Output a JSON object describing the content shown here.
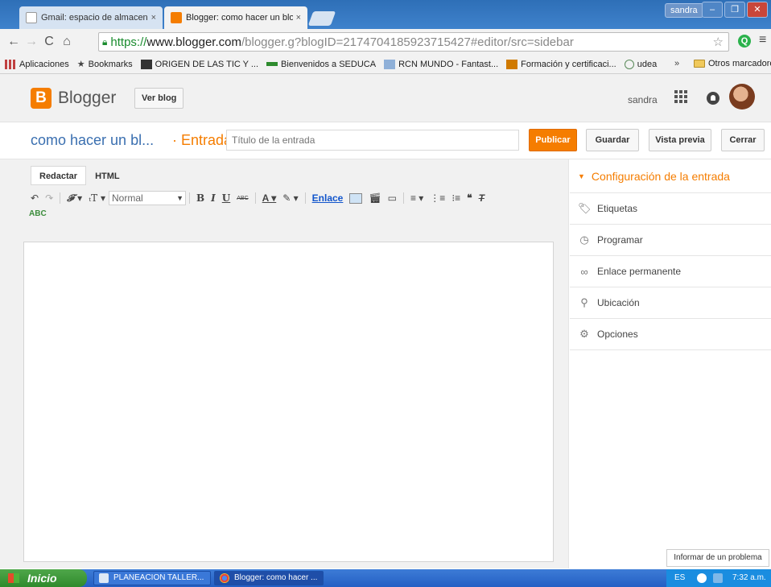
{
  "browser": {
    "tabs": [
      {
        "title": "Gmail: espacio de almacenam",
        "close": "×",
        "active": false
      },
      {
        "title": "Blogger: como hacer un blog",
        "close": "×",
        "active": true
      }
    ],
    "profile_user": "sandra",
    "window_buttons": [
      "–",
      "❐",
      "✕"
    ],
    "url": {
      "scheme": "https://",
      "host": "www.blogger.com",
      "path": "/blogger.g?blogID=2174704185923715427#editor/src=sidebar"
    },
    "extension_label": "Q",
    "bookmarks": [
      {
        "label": "Aplicaciones",
        "icon": "apps-grid-icon",
        "color": "#c04040"
      },
      {
        "label": "Bookmarks",
        "icon": "star-icon",
        "color": "#444444"
      },
      {
        "label": "ORIGEN DE LAS TIC Y ...",
        "icon": "ci-logo-icon",
        "color": "#333333"
      },
      {
        "label": "Bienvenidos a SEDUCA",
        "icon": "seduca-icon",
        "color": "#2e8b2e"
      },
      {
        "label": "RCN MUNDO - Fantast...",
        "icon": "rcn-icon",
        "color": "#3a6fb0"
      },
      {
        "label": "Formación y certificaci...",
        "icon": "fm-icon",
        "color": "#d07a00"
      },
      {
        "label": "udea",
        "icon": "udea-icon",
        "color": "#5a8a5a"
      }
    ],
    "bookmarks_more": "»",
    "bookmarks_other": "Otros marcadores"
  },
  "blogger": {
    "logo_letter": "B",
    "brand": "Blogger",
    "view_blog": "Ver blog",
    "username": "sandra",
    "blog_name": "como hacer un bl...",
    "section": "· Entrada",
    "title_placeholder": "Título de la entrada",
    "buttons": {
      "publish": "Publicar",
      "save": "Guardar",
      "preview": "Vista previa",
      "close": "Cerrar"
    },
    "mode_tabs": [
      "Redactar",
      "HTML"
    ],
    "font_size": "Normal",
    "link_label": "Enlace",
    "spell_label": "ABC",
    "settings": {
      "header": "Configuración de la entrada",
      "items": [
        {
          "label": "Etiquetas",
          "icon": "tag-icon"
        },
        {
          "label": "Programar",
          "icon": "clock-icon"
        },
        {
          "label": "Enlace permanente",
          "icon": "link-icon"
        },
        {
          "label": "Ubicación",
          "icon": "location-pin-icon"
        },
        {
          "label": "Opciones",
          "icon": "gear-icon"
        }
      ]
    },
    "report_problem": "Informar de un problema"
  },
  "taskbar": {
    "start": "Inicio",
    "items": [
      "PLANEACION TALLER...",
      "Blogger: como hacer ..."
    ],
    "language": "ES",
    "time": "7:32 a.m."
  },
  "colors": {
    "accent_orange": "#f57d00",
    "link_blue": "#3a6fb0"
  }
}
